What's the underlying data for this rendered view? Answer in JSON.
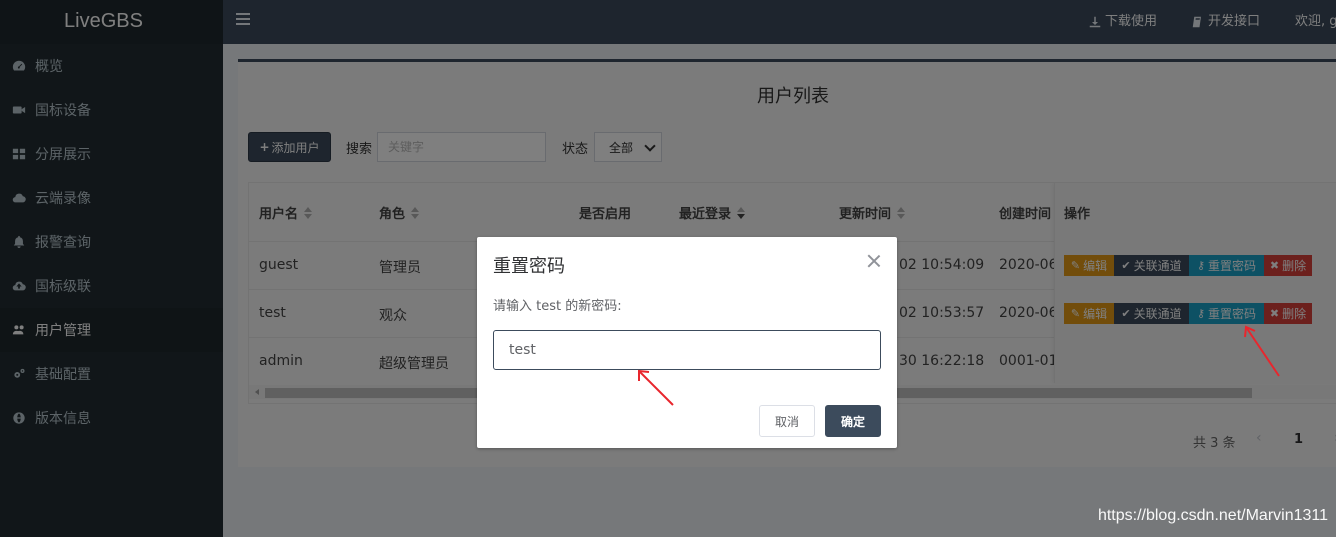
{
  "brand": "LiveGBS",
  "header": {
    "download": "下载使用",
    "api": "开发接口",
    "welcome": "欢迎, g"
  },
  "sidebar": {
    "items": [
      {
        "label": "概览",
        "icon": "dashboard-icon"
      },
      {
        "label": "国标设备",
        "icon": "video-camera-icon"
      },
      {
        "label": "分屏展示",
        "icon": "grid-icon"
      },
      {
        "label": "云端录像",
        "icon": "cloud-icon"
      },
      {
        "label": "报警查询",
        "icon": "bell-icon"
      },
      {
        "label": "国标级联",
        "icon": "cloud-upload-icon"
      },
      {
        "label": "用户管理",
        "icon": "users-icon",
        "active": true
      },
      {
        "label": "基础配置",
        "icon": "gears-icon"
      },
      {
        "label": "版本信息",
        "icon": "globe-icon"
      }
    ]
  },
  "page": {
    "title": "用户列表",
    "add_user": "添加用户",
    "search_label": "搜索",
    "search_placeholder": "关键字",
    "status_label": "状态",
    "status_value": "全部"
  },
  "table": {
    "headers": [
      "用户名",
      "角色",
      "是否启用",
      "最近登录",
      "更新时间",
      "创建时间",
      "操作"
    ],
    "rows": [
      {
        "username": "guest",
        "role": "管理员",
        "updated": "02 10:54:09",
        "created": "2020-06-"
      },
      {
        "username": "test",
        "role": "观众",
        "updated": "02 10:53:57",
        "created": "2020-06-"
      },
      {
        "username": "admin",
        "role": "超级管理员",
        "updated": "30 16:22:18",
        "created": "0001-01-"
      }
    ],
    "actions": {
      "edit": "编辑",
      "link_channel": "关联通道",
      "reset_password": "重置密码",
      "delete": "删除"
    }
  },
  "pager": {
    "total": "共 3 条",
    "current": "1"
  },
  "modal": {
    "title": "重置密码",
    "message": "请输入 test 的新密码:",
    "input_value": "test",
    "cancel": "取消",
    "ok": "确定"
  },
  "watermark": "https://blog.csdn.net/Marvin1311",
  "colors": {
    "sidebar_bg": "#222d32",
    "header_bg": "#3c4b5c",
    "edit": "#e49b17",
    "reset": "#1aa3c8",
    "delete": "#d9413b",
    "arrow": "#e8262d"
  }
}
